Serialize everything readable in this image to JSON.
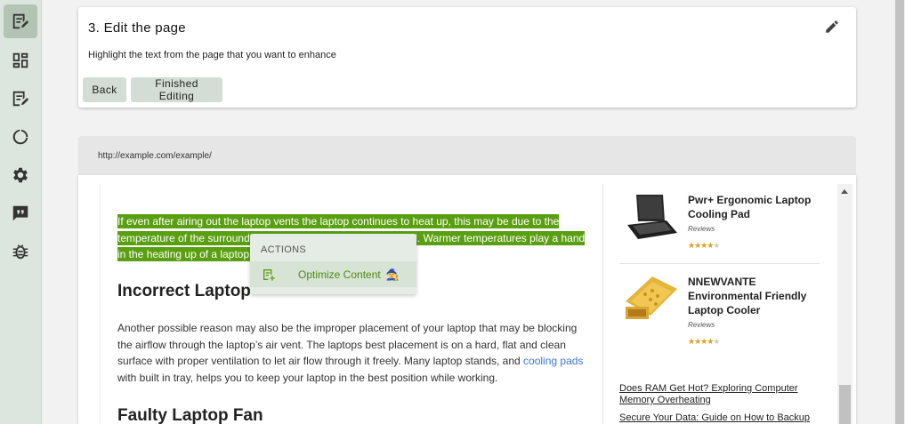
{
  "sidebar": {
    "items": [
      {
        "icon": "edit-document-icon",
        "active": true
      },
      {
        "icon": "dashboard-icon",
        "active": false
      },
      {
        "icon": "document-list-icon",
        "active": false
      },
      {
        "icon": "progress-circle-icon",
        "active": false
      },
      {
        "icon": "gear-icon",
        "active": false
      },
      {
        "icon": "feedback-icon",
        "active": false
      },
      {
        "icon": "bug-icon",
        "active": false
      }
    ]
  },
  "edit_card": {
    "title": "3. Edit the page",
    "description": "Highlight the text from the page that you want to enhance",
    "back_label": "Back",
    "finish_label": "Finished Editing"
  },
  "url": "http://example.com/example/",
  "article": {
    "highlighted_text": "If even after airing out the laptop vents the laptop continues to heat up, this may be due to the temperature of the surroundings where the laptop is being used. Warmer temperatures play a hand in the heating up of a laptop.",
    "heading1": "Incorrect Laptop",
    "para_text": "Another possible reason may also be the improper placement of your laptop that may be blocking the airflow through the laptop’s air vent. The laptops best placement is on a hard, flat and clean surface with proper ventilation to let air flow through it freely. Many laptop stands, and ",
    "para_link": "cooling pads",
    "para_text_end": " with built in tray, helps you to keep your laptop in the best position while working.",
    "heading2": "Faulty Laptop Fan"
  },
  "actions_popup": {
    "header": "ACTIONS",
    "item_label": "Optimize Content",
    "item_emoji": "🧙"
  },
  "products": [
    {
      "name": "Pwr+ Ergonomic Laptop Cooling Pad",
      "reviews_label": "Reviews",
      "rating": 4,
      "max_rating": 5
    },
    {
      "name": "NNEWVANTE Environmental Friendly Laptop Cooler",
      "reviews_label": "Reviews",
      "rating": 4,
      "max_rating": 5
    }
  ],
  "related_links": [
    "Does RAM Get Hot? Exploring Computer Memory Overheating",
    "Secure Your Data: Guide on How to Backup"
  ],
  "colors": {
    "highlight": "#5a9e12",
    "accent_green": "#4d8c12",
    "link_blue": "#3b78d8",
    "sidebar_bg": "#dde6de"
  }
}
